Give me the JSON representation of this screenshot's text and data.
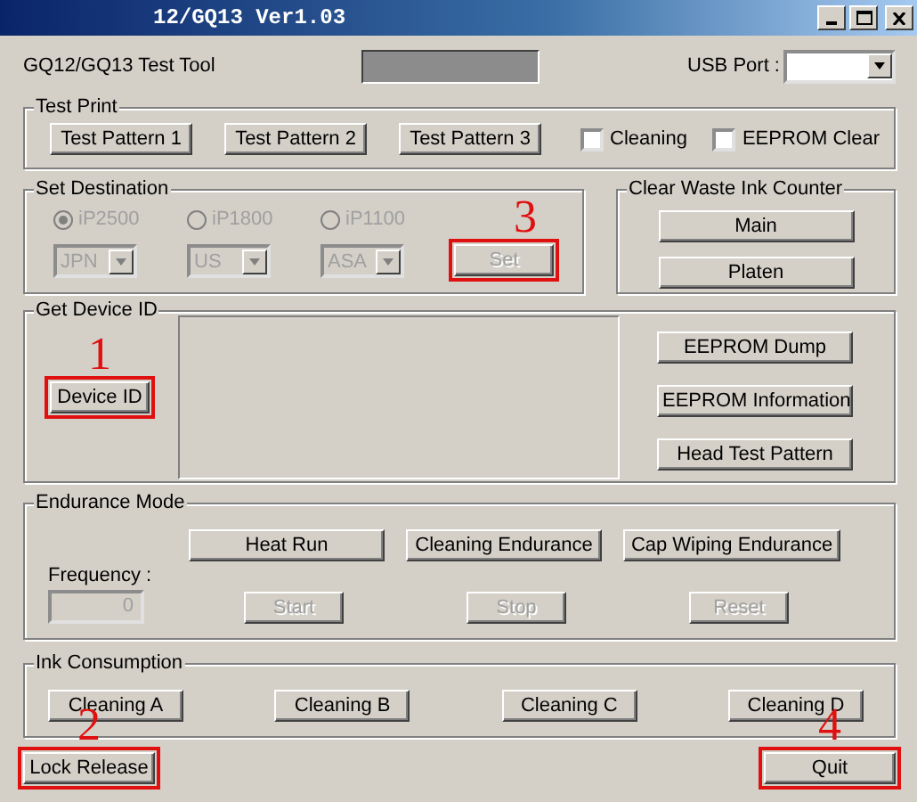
{
  "window": {
    "title": "12/GQ13 Ver1.03"
  },
  "header": {
    "app_name": "GQ12/GQ13 Test Tool",
    "usb_port_label": "USB Port :"
  },
  "test_print": {
    "title": "Test Print",
    "buttons": [
      {
        "label": "Test Pattern 1",
        "disabled": false
      },
      {
        "label": "Test Pattern 2",
        "disabled": false
      },
      {
        "label": "Test Pattern 3",
        "disabled": false
      }
    ],
    "checkboxes": [
      {
        "label": "Cleaning",
        "checked": false
      },
      {
        "label": "EEPROM Clear",
        "checked": false
      }
    ]
  },
  "set_destination": {
    "title": "Set Destination",
    "radios": [
      {
        "label": "iP2500",
        "selected": true,
        "disabled": true
      },
      {
        "label": "iP1800",
        "selected": false,
        "disabled": true
      },
      {
        "label": "iP1100",
        "selected": false,
        "disabled": true
      }
    ],
    "regions": [
      {
        "value": "JPN",
        "disabled": true
      },
      {
        "value": "US",
        "disabled": true
      },
      {
        "value": "ASA",
        "disabled": true
      }
    ],
    "set_button": {
      "label": "Set",
      "disabled": true,
      "annotation": "3"
    }
  },
  "clear_waste_ink_counter": {
    "title": "Clear Waste Ink Counter",
    "buttons": [
      {
        "label": "Main",
        "disabled": false
      },
      {
        "label": "Platen",
        "disabled": false
      }
    ]
  },
  "get_device_id": {
    "title": "Get Device ID",
    "device_id_button": {
      "label": "Device ID",
      "disabled": false,
      "annotation": "1"
    },
    "buttons": [
      {
        "label": "EEPROM Dump",
        "disabled": false
      },
      {
        "label": "EEPROM Information",
        "disabled": false
      },
      {
        "label": "Head Test Pattern",
        "disabled": false
      }
    ]
  },
  "endurance_mode": {
    "title": "Endurance Mode",
    "buttons": [
      {
        "label": "Heat Run",
        "disabled": false
      },
      {
        "label": "Cleaning Endurance",
        "disabled": false
      },
      {
        "label": "Cap Wiping Endurance",
        "disabled": false
      }
    ],
    "frequency_label": "Frequency :",
    "frequency": {
      "value": "0",
      "disabled": true
    },
    "control_buttons": [
      {
        "label": "Start",
        "disabled": true
      },
      {
        "label": "Stop",
        "disabled": true
      },
      {
        "label": "Reset",
        "disabled": true
      }
    ]
  },
  "ink_consumption": {
    "title": "Ink Consumption",
    "buttons": [
      {
        "label": "Cleaning A",
        "disabled": false
      },
      {
        "label": "Cleaning B",
        "disabled": false
      },
      {
        "label": "Cleaning C",
        "disabled": false
      },
      {
        "label": "Cleaning D",
        "disabled": false
      }
    ]
  },
  "footer_buttons": [
    {
      "label": "Lock Release",
      "disabled": false,
      "annotation": "2"
    },
    {
      "label": "Quit",
      "disabled": false,
      "annotation": "4"
    }
  ]
}
